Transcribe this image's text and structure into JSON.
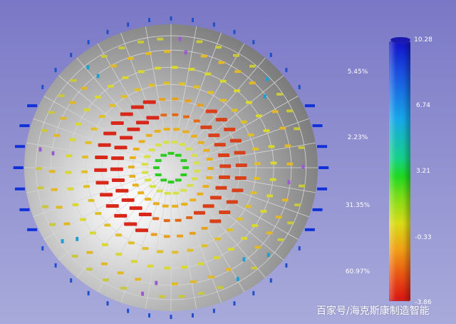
{
  "percent_labels": [
    "5.45%",
    "2.23%",
    "31.35%",
    "60.97%"
  ],
  "colorbar": {
    "ticks": [
      "10.28",
      "6.74",
      "3.21",
      "-0.33",
      "-3.86"
    ],
    "top_color": "#1111c8",
    "bottom_color": "#d81212"
  },
  "watermark": "百家号/海克斯康制造智能"
}
